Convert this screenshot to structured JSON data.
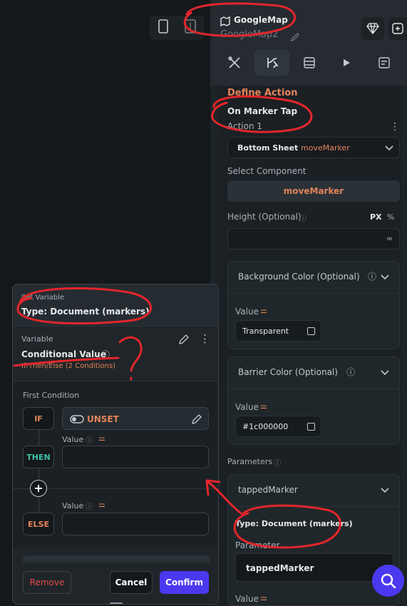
{
  "header": {
    "component_type": "GoogleMap",
    "component_name": "GoogleMap2"
  },
  "panel": {
    "section_title": "Define Action",
    "trigger": "On Marker Tap",
    "action_label": "Action 1",
    "action_type": "Bottom Sheet",
    "action_target": "moveMarker",
    "select_component_label": "Select Component",
    "select_component_value": "moveMarker",
    "height_label": "Height (Optional)",
    "height_unit_px": "PX",
    "height_unit_pct": "%",
    "height_value": "∞",
    "bg_color_label": "Background Color (Optional)",
    "bg_value_label": "Value",
    "bg_value": "Transparent",
    "barrier_label": "Barrier Color (Optional)",
    "barrier_value_label": "Value",
    "barrier_value": "#1c000000",
    "parameters_label": "Parameters",
    "param_name": "tappedMarker",
    "param_type": "Type: Document (markers)",
    "parameter_field_label": "Parameter",
    "parameter_value": "tappedMarker",
    "value_label": "Value"
  },
  "dialog": {
    "set_variable_label": "Set Variable",
    "set_variable_type": "Type: Document (markers)",
    "variable_label": "Variable",
    "variable_value": "Conditional Value",
    "variable_sub": "If/Then/Else (2 Conditions)",
    "first_condition": "First Condition",
    "if_label": "IF",
    "if_value": "UNSET",
    "then_label": "THEN",
    "else_label": "ELSE",
    "value_label": "Value",
    "value_label_2": "Value",
    "remove": "Remove",
    "cancel": "Cancel",
    "confirm": "Confirm"
  },
  "colors": {
    "accent": "#e4845a",
    "confirm": "#4b39ef",
    "annotation": "#e3262b",
    "then": "#3fc1a8",
    "if": "#e4845a",
    "else": "#e4845a"
  }
}
